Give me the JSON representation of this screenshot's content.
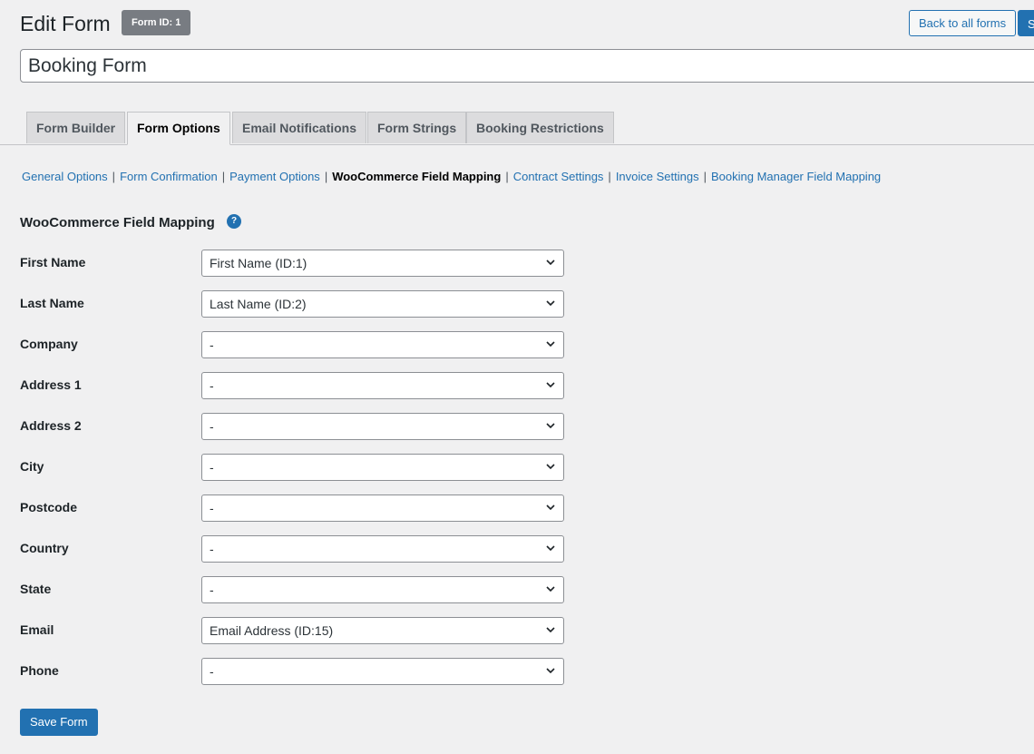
{
  "header": {
    "title": "Edit Form",
    "form_id_badge": "Form ID: 1",
    "back_button": "Back to all forms",
    "save_button_partial": "Save Form"
  },
  "form_title": {
    "value": "Booking Form"
  },
  "tabs": [
    {
      "label": "Form Builder",
      "active": false
    },
    {
      "label": "Form Options",
      "active": true
    },
    {
      "label": "Email Notifications",
      "active": false
    },
    {
      "label": "Form Strings",
      "active": false
    },
    {
      "label": "Booking Restrictions",
      "active": false
    }
  ],
  "subnav": [
    {
      "label": "General Options",
      "current": false
    },
    {
      "label": "Form Confirmation",
      "current": false
    },
    {
      "label": "Payment Options",
      "current": false
    },
    {
      "label": "WooCommerce Field Mapping",
      "current": true
    },
    {
      "label": "Contract Settings",
      "current": false
    },
    {
      "label": "Invoice Settings",
      "current": false
    },
    {
      "label": "Booking Manager Field Mapping",
      "current": false
    }
  ],
  "section": {
    "heading": "WooCommerce Field Mapping",
    "help_icon": "?"
  },
  "fields": [
    {
      "label": "First Name",
      "value": "First Name (ID:1)"
    },
    {
      "label": "Last Name",
      "value": "Last Name (ID:2)"
    },
    {
      "label": "Company",
      "value": "-"
    },
    {
      "label": "Address 1",
      "value": "-"
    },
    {
      "label": "Address 2",
      "value": "-"
    },
    {
      "label": "City",
      "value": "-"
    },
    {
      "label": "Postcode",
      "value": "-"
    },
    {
      "label": "Country",
      "value": "-"
    },
    {
      "label": "State",
      "value": "-"
    },
    {
      "label": "Email",
      "value": "Email Address (ID:15)"
    },
    {
      "label": "Phone",
      "value": "-"
    }
  ],
  "footer": {
    "save_button": "Save Form"
  },
  "colors": {
    "accent": "#2271b1",
    "background": "#f0f0f1",
    "badge": "#787c82"
  }
}
